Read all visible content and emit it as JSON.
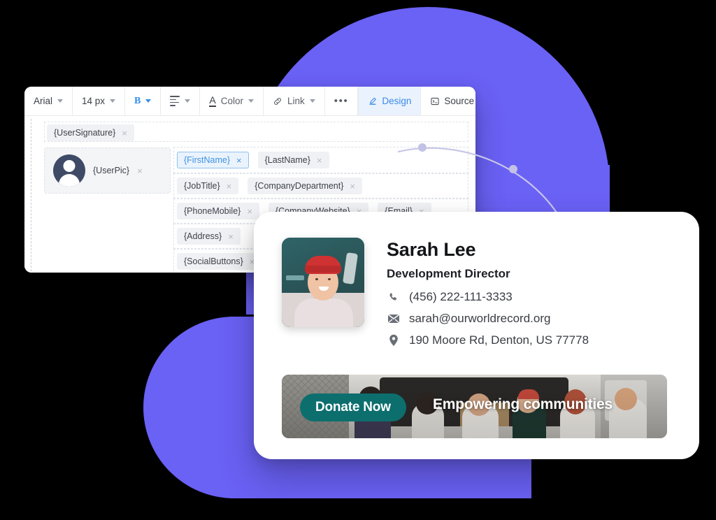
{
  "editor": {
    "toolbar": {
      "font_family": "Arial",
      "font_size": "14 px",
      "bold_label": "B",
      "color_label": "Color",
      "color_glyph": "A",
      "link_label": "Link",
      "more_label": "•••",
      "design_label": "Design",
      "source_label": "Source"
    },
    "tokens": {
      "user_signature": "{UserSignature}",
      "user_pic": "{UserPic}",
      "first_name": "{FirstName}",
      "last_name": "{LastName}",
      "job_title": "{JobTitle}",
      "company_department": "{CompanyDepartment}",
      "phone_mobile": "{PhoneMobile}",
      "company_website": "{CompanyWebsite}",
      "email": "{Email}",
      "address": "{Address}",
      "social_buttons": "{SocialButtons}",
      "remove_glyph": "×"
    }
  },
  "signature": {
    "name": "Sarah Lee",
    "title": "Development Director",
    "phone": "(456) 222-111-3333",
    "email": "sarah@ourworldrecord.org",
    "address": "190 Moore Rd, Denton, US 77778",
    "banner": {
      "cta_label": "Donate Now",
      "tagline": "Empowering communities"
    }
  },
  "theme": {
    "purple": "#6A61F5",
    "accent_blue": "#4092E4",
    "teal": "#0D6E6E",
    "curve": "#C7C6E8"
  }
}
